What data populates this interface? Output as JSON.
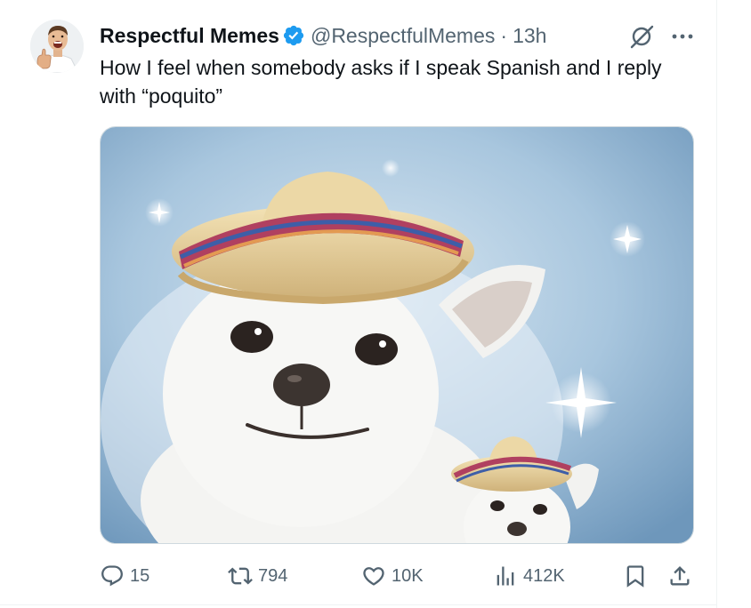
{
  "tweet": {
    "author_name": "Respectful Memes",
    "handle": "@RespectfulMemes",
    "separator": "·",
    "time": "13h",
    "text": "How I feel when somebody asks if I speak Spanish and I reply with “poquito”"
  },
  "actions": {
    "replies": "15",
    "reposts": "794",
    "likes": "10K",
    "views": "412K"
  },
  "icons": {
    "verified": "verified-badge-icon",
    "grok": "grok-icon",
    "more": "more-icon",
    "reply": "reply-icon",
    "repost": "repost-icon",
    "like": "heart-icon",
    "views": "views-chart-icon",
    "bookmark": "bookmark-icon",
    "share": "share-icon"
  },
  "colors": {
    "text_primary": "#0f1419",
    "text_secondary": "#536471",
    "verified_blue": "#1d9bf0"
  }
}
